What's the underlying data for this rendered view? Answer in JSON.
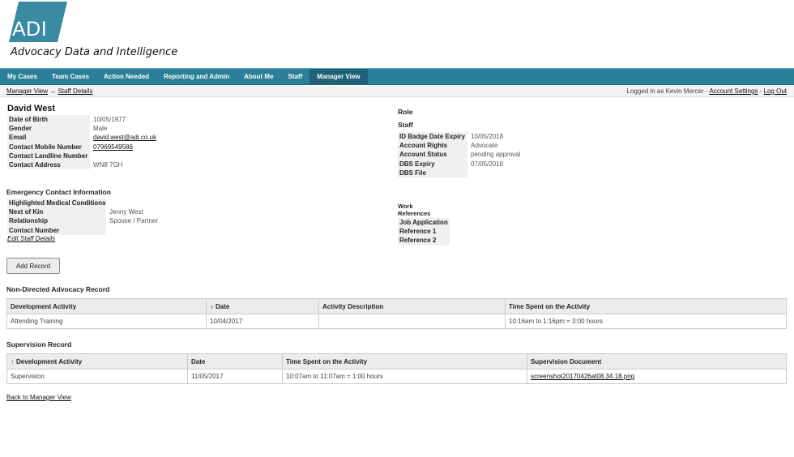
{
  "brand": {
    "logo_text": "ADI",
    "tagline": "Advocacy Data and Intelligence",
    "logo_color": "#3a8aa2"
  },
  "nav": {
    "items": [
      {
        "label": "My Cases"
      },
      {
        "label": "Team Cases"
      },
      {
        "label": "Action Needed"
      },
      {
        "label": "Reporting and Admin"
      },
      {
        "label": "About Me"
      },
      {
        "label": "Staff"
      },
      {
        "label": "Manager View",
        "active": true
      }
    ]
  },
  "breadcrumb": {
    "root": "Manager View",
    "arrow": " → ",
    "current": "Staff Details"
  },
  "session": {
    "logged_in_text": "Logged in as Kevin Mercer - ",
    "account_settings": "Account Settings",
    "separator": " - ",
    "logout": "Log Out"
  },
  "staff": {
    "name": "David West",
    "details": [
      {
        "label": "Date of Birth",
        "value": "10/05/1977"
      },
      {
        "label": "Gender",
        "value": "Male"
      },
      {
        "label": "Email",
        "value": "david.west@adi.co.uk"
      },
      {
        "label": "Contact Mobile Number",
        "value": "07969549586"
      },
      {
        "label": "Contact Landline Number",
        "value": ""
      },
      {
        "label": "Contact Address",
        "value": "WN8 7GH"
      }
    ],
    "role_label": "Role",
    "role_value": "Staff",
    "account": [
      {
        "label": "ID Badge Date Expiry",
        "value": "10/05/2018"
      },
      {
        "label": "Account Rights",
        "value": "Advocate"
      },
      {
        "label": "Account Status",
        "value": "pending approval"
      },
      {
        "label": "DBS Expiry",
        "value": "07/05/2018"
      },
      {
        "label": "DBS File",
        "value": ""
      }
    ]
  },
  "emergency": {
    "heading": "Emergency Contact Information",
    "rows": [
      {
        "label": "Highlighted Medical Conditions",
        "value": ""
      },
      {
        "label": "Next of Kin",
        "value": "Jenny West"
      },
      {
        "label": "Relationship",
        "value": "Spouse / Partner"
      },
      {
        "label": "Contact Number",
        "value": ""
      }
    ],
    "edit_link": "Edit Staff Details"
  },
  "work_refs": {
    "heading_line1": "Work",
    "heading_line2": "References",
    "rows": [
      {
        "label": "Job Application"
      },
      {
        "label": "Reference 1"
      },
      {
        "label": "Reference 2"
      }
    ]
  },
  "add_record_button": "Add Record",
  "non_directed": {
    "heading": "Non-Directed Advocacy Record",
    "columns": [
      "Development Activity",
      "Date",
      "Activity Description",
      "Time Spent on the Activity"
    ],
    "rows": [
      [
        "Attending Training",
        "10/04/2017",
        "",
        "10:16am to 1:16pm = 3:00 hours"
      ]
    ]
  },
  "supervision": {
    "heading": "Supervision Record",
    "columns": [
      "Development Activity",
      "Date",
      "Time Spent on the Activity",
      "Supervision Document"
    ],
    "rows": [
      [
        "Supervision",
        "11/05/2017",
        "10:07am to 11:07am = 1:00 hours",
        "screenshot20170426at08.34.18.png"
      ]
    ]
  },
  "back_link": "Back to Manager View",
  "sort_glyph": "⇕",
  "sort_up_glyph": "⇡"
}
